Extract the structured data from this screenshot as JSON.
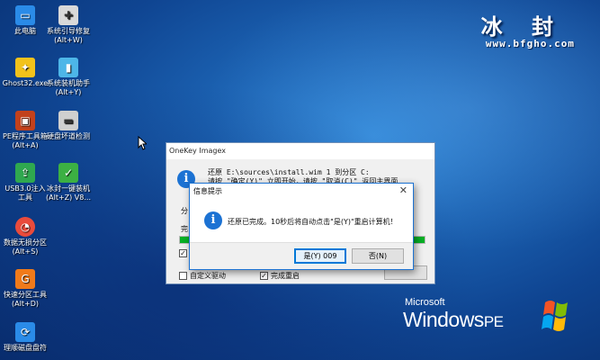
{
  "desktop_icons": [
    {
      "label": "此电脑",
      "icon": "computer-icon",
      "color": "#2a8be8"
    },
    {
      "label": "系统引导修复\n(Alt+W)",
      "icon": "repair-tool-icon",
      "color": "#d9d9d9"
    },
    {
      "label": "Ghost32.exe",
      "icon": "ghost-icon",
      "color": "#f2c21b"
    },
    {
      "label": "系统装机助手\n(Alt+Y)",
      "icon": "install-helper-icon",
      "color": "#4db6e8"
    },
    {
      "label": "PE程序工具箱\n(Alt+A)",
      "icon": "toolbox-icon",
      "color": "#c2411c"
    },
    {
      "label": "硬盘坏道检测",
      "icon": "hdd-check-icon",
      "color": "#cfcfcf"
    },
    {
      "label": "USB3.0注入\n工具",
      "icon": "usb-inject-icon",
      "color": "#2fa84f"
    },
    {
      "label": "冰封一键装机\n(Alt+Z) V8...",
      "icon": "one-key-install-icon",
      "color": "#3cb043"
    },
    {
      "label": "数据无损分区\n(Alt+S)",
      "icon": "partition-icon",
      "color": "#e94b3c"
    },
    {
      "label": "快速分区工具\n(Alt+D)",
      "icon": "quick-partition-icon",
      "color": "#f07a1a"
    },
    {
      "label": "理顺磁盘盘符",
      "icon": "drive-letter-icon",
      "color": "#2a8be8"
    }
  ],
  "brand": {
    "name": "冰 封",
    "url": "www.bfgho.com"
  },
  "windows_logo": {
    "microsoft": "Microsoft",
    "windows": "Windows",
    "pe": "PE"
  },
  "main_window": {
    "title": "OneKey Imagex",
    "text_line1": "还原 E:\\sources\\install.wim 1 到分区 C:",
    "text_line2": "请按 \"确定(Y)\" 立即开始，请按 \"取消(C)\" 返回主界面",
    "label_partition": "分",
    "label_complete": "完",
    "progress_fraction": 1.0,
    "check1_label": "还",
    "check2_label": "自定义驱动",
    "check3_label": "完成重启"
  },
  "message_box": {
    "title": "信息提示",
    "text": "还原已完成。10秒后将自动点击\"是(Y)\"重启计算机！",
    "yes_button": "是(Y) 009",
    "no_button": "否(N)"
  }
}
